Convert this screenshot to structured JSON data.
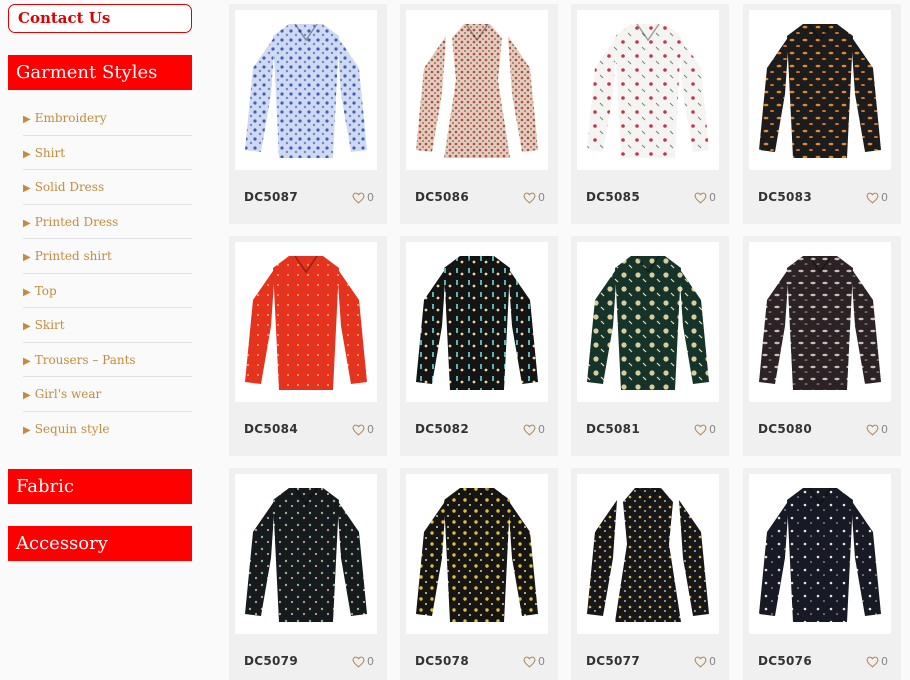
{
  "sidebar": {
    "contact_label": "Contact Us",
    "garment_header": "Garment Styles",
    "items": [
      "Embroidery",
      "Shirt",
      "Solid Dress",
      "Printed Dress",
      "Printed shirt",
      "Top",
      "Skirt",
      "Trousers – Pants",
      "Girl's wear",
      "Sequin style"
    ],
    "fabric_header": "Fabric",
    "accessory_header": "Accessory"
  },
  "products": [
    {
      "code": "DC5087",
      "likes": "0",
      "image": "blue-floral-cold-shoulder-top"
    },
    {
      "code": "DC5086",
      "likes": "0",
      "image": "rust-ditsy-shirt-dress"
    },
    {
      "code": "DC5085",
      "likes": "0",
      "image": "white-floral-tie-neck-blouse"
    },
    {
      "code": "DC5083",
      "likes": "0",
      "image": "black-bird-print-blouse"
    },
    {
      "code": "DC5084",
      "likes": "0",
      "image": "red-ruched-blouse"
    },
    {
      "code": "DC5082",
      "likes": "0",
      "image": "black-folk-print-shirt"
    },
    {
      "code": "DC5081",
      "likes": "0",
      "image": "green-botanical-blouse"
    },
    {
      "code": "DC5080",
      "likes": "0",
      "image": "black-leaf-print-blouse"
    },
    {
      "code": "DC5079",
      "likes": "0",
      "image": "black-ruffle-floral-blouse"
    },
    {
      "code": "DC5078",
      "likes": "0",
      "image": "black-yellow-floral-shirt"
    },
    {
      "code": "DC5077",
      "likes": "0",
      "image": "black-floral-dress"
    },
    {
      "code": "DC5076",
      "likes": "0",
      "image": "black-tie-neck-floral-blouse"
    }
  ],
  "colors": {
    "accent": "#ff0000",
    "link": "#c58b3c"
  }
}
